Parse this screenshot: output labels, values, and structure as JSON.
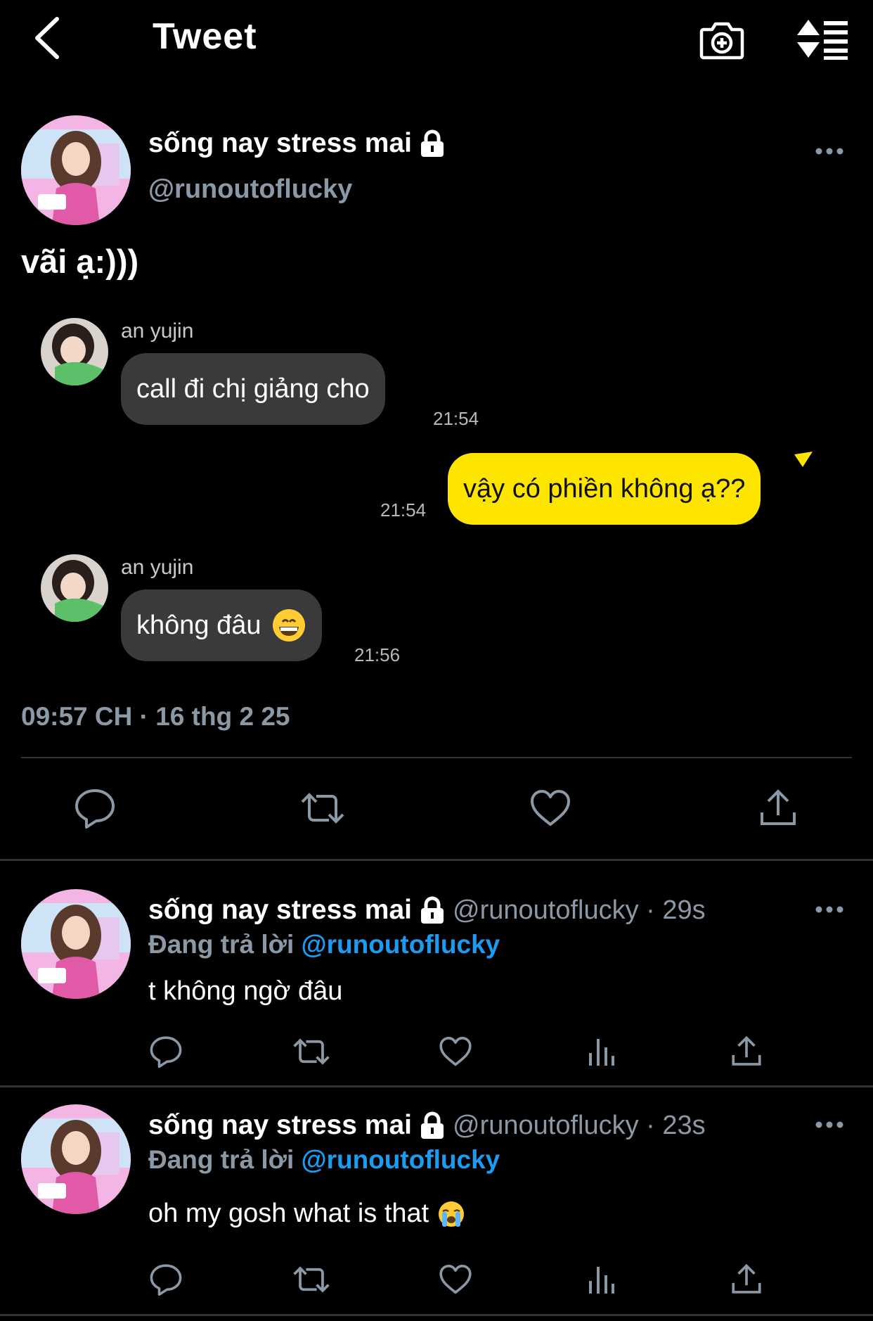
{
  "header": {
    "title": "Tweet",
    "back_icon": "chevron-left-icon",
    "camera_icon": "camera-plus-icon",
    "sort_icon": "sort-list-icon"
  },
  "main_tweet": {
    "display_name": "sống nay stress mai",
    "handle": "@runoutoflucky",
    "text": "vãi ạ:)))",
    "timestamp": "09:57 CH · 16 thg 2 25"
  },
  "chat": [
    {
      "sender": "an yujin",
      "text": "call đi chị giảng cho",
      "time": "21:54"
    },
    {
      "text": "vậy có phiền không ạ??",
      "time": "21:54"
    },
    {
      "sender": "an yujin",
      "text": "không đâu",
      "emoji": "grinning-face",
      "time": "21:56"
    }
  ],
  "replies": [
    {
      "display_name": "sống nay stress mai",
      "meta": "@runoutoflucky · 29s",
      "replying_label": "Đang trả lời",
      "replying_to": "@runoutoflucky",
      "text": "t không ngờ đâu"
    },
    {
      "display_name": "sống nay stress mai",
      "meta": "@runoutoflucky · 23s",
      "replying_label": "Đang trả lời",
      "replying_to": "@runoutoflucky",
      "text": "oh my gosh what is that",
      "emoji": "loudly-crying-face"
    }
  ],
  "colors": {
    "accent": "#1d9bf0",
    "chat_yellow": "#fee500",
    "chat_gray": "#3a3a3c",
    "muted": "#8b98a5"
  }
}
